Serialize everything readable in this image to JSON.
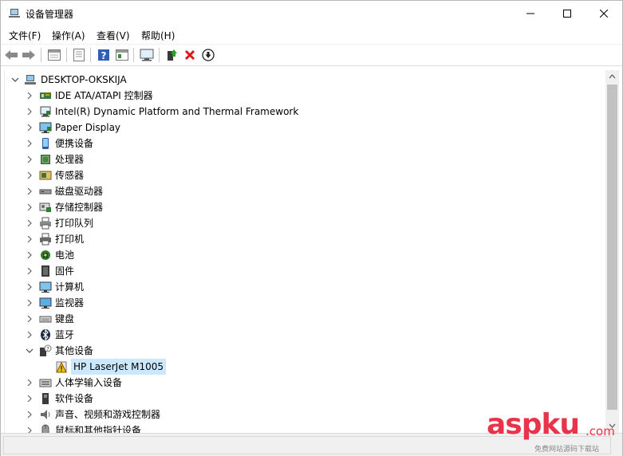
{
  "window": {
    "title": "设备管理器",
    "controls": {
      "minimize": "minimize-icon",
      "maximize": "maximize-icon",
      "close": "close-icon"
    }
  },
  "menu": [
    "文件(F)",
    "操作(A)",
    "查看(V)",
    "帮助(H)"
  ],
  "toolbar": {
    "buttons": [
      "back-icon",
      "forward-icon",
      "properties-view-icon",
      "document-icon",
      "help-icon",
      "panel-view-icon",
      "monitor-scan-icon",
      "update-driver-icon",
      "uninstall-x-icon",
      "download-arrow-icon"
    ]
  },
  "tree": {
    "root": "DESKTOP-OKSKIJA",
    "items": [
      {
        "label": "IDE ATA/ATAPI 控制器",
        "icon": "ide-controller-icon",
        "expanded": false
      },
      {
        "label": "Intel(R) Dynamic Platform and Thermal Framework",
        "icon": "thermal-framework-icon",
        "expanded": false
      },
      {
        "label": "Paper Display",
        "icon": "paper-display-icon",
        "expanded": false
      },
      {
        "label": "便携设备",
        "icon": "portable-device-icon",
        "expanded": false
      },
      {
        "label": "处理器",
        "icon": "processor-icon",
        "expanded": false
      },
      {
        "label": "传感器",
        "icon": "sensor-icon",
        "expanded": false
      },
      {
        "label": "磁盘驱动器",
        "icon": "disk-drive-icon",
        "expanded": false
      },
      {
        "label": "存储控制器",
        "icon": "storage-controller-icon",
        "expanded": false
      },
      {
        "label": "打印队列",
        "icon": "print-queue-icon",
        "expanded": false
      },
      {
        "label": "打印机",
        "icon": "printer-icon",
        "expanded": false
      },
      {
        "label": "电池",
        "icon": "battery-icon",
        "expanded": false
      },
      {
        "label": "固件",
        "icon": "firmware-icon",
        "expanded": false
      },
      {
        "label": "计算机",
        "icon": "computer-icon",
        "expanded": false
      },
      {
        "label": "监视器",
        "icon": "monitor-icon",
        "expanded": false
      },
      {
        "label": "键盘",
        "icon": "keyboard-icon",
        "expanded": false
      },
      {
        "label": "蓝牙",
        "icon": "bluetooth-icon",
        "expanded": false
      },
      {
        "label": "其他设备",
        "icon": "other-devices-icon",
        "expanded": true
      },
      {
        "label": "HP LaserJet M1005",
        "icon": "warning-device-icon",
        "child": true,
        "selected": true
      },
      {
        "label": "人体学输入设备",
        "icon": "hid-icon",
        "expanded": false
      },
      {
        "label": "软件设备",
        "icon": "software-device-icon",
        "expanded": false
      },
      {
        "label": "声音、视频和游戏控制器",
        "icon": "sound-icon",
        "expanded": false
      },
      {
        "label": "鼠标和其他指针设备",
        "icon": "mouse-icon",
        "expanded": false
      }
    ]
  },
  "watermark": {
    "main": "aspku",
    "suffix": ".com",
    "sub": "免费网站源码下载站"
  },
  "colors": {
    "selection": "#cce8ff",
    "warning": "#f2c200",
    "delete": "#e01515",
    "watermark": "#e8334a"
  }
}
